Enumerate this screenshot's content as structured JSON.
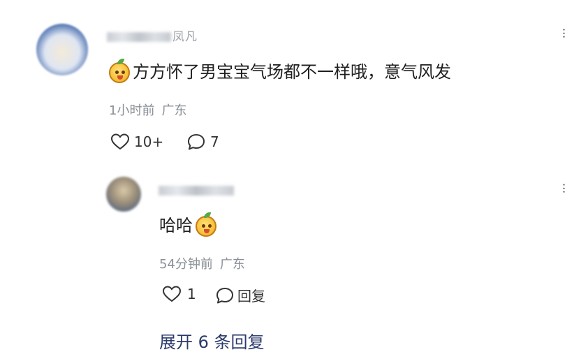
{
  "comment": {
    "username_visible": "凤凡",
    "text": "方方怀了男宝宝气场都不一样哦，意气风发",
    "time": "1小时前",
    "location": "广东",
    "likes": "10+",
    "replies": "7",
    "emoji_icon": "smiling-mango-emoji"
  },
  "reply": {
    "text": "哈哈",
    "time": "54分钟前",
    "location": "广东",
    "likes": "1",
    "reply_label": "回复",
    "emoji_icon": "smiling-mango-emoji"
  },
  "expand_label": "展开 6 条回复",
  "more_glyph": "···",
  "colors": {
    "text": "#1f1f1f",
    "meta": "#8a8f96",
    "expand": "#2b3a6b"
  }
}
